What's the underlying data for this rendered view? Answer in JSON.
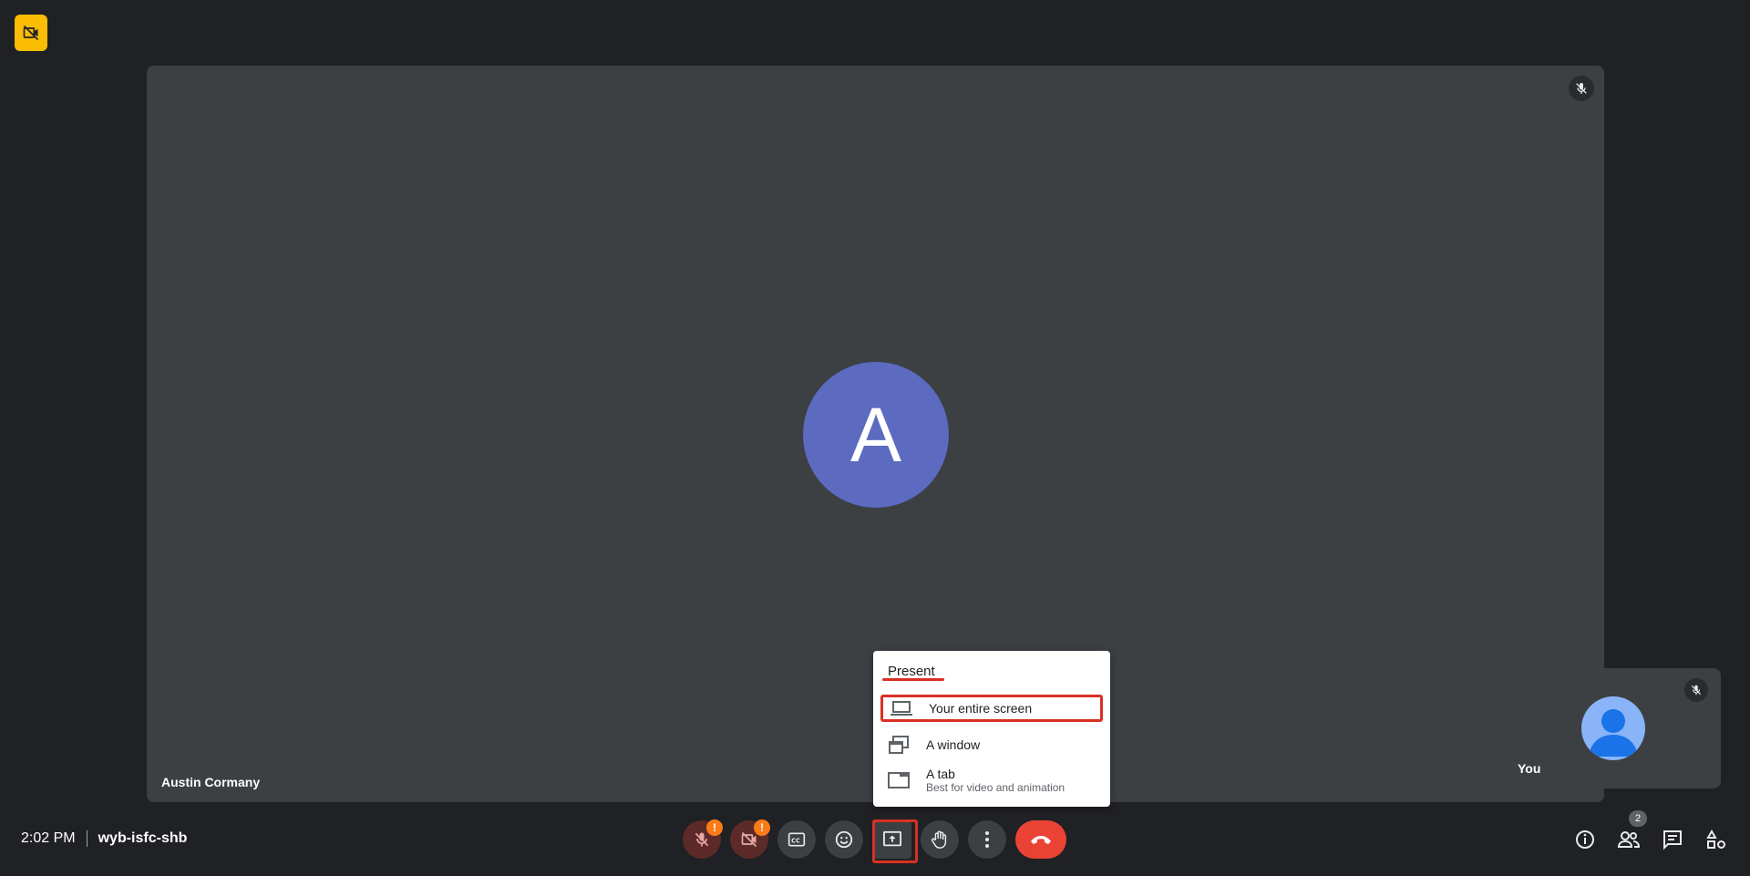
{
  "meeting": {
    "time": "2:02 PM",
    "code": "wyb-isfc-shb"
  },
  "main_tile": {
    "avatar_letter": "A",
    "participant_name": "Austin Cormany",
    "avatar_color": "#5c6bc0",
    "mic_state": "muted"
  },
  "self_tile": {
    "label": "You",
    "mic_state": "muted"
  },
  "present_menu": {
    "title": "Present",
    "items": [
      {
        "label": "Your entire screen",
        "icon": "laptop-icon",
        "highlighted": true
      },
      {
        "label": "A window",
        "icon": "window-icon"
      },
      {
        "label": "A tab",
        "sublabel": "Best for video and animation",
        "icon": "tab-icon"
      }
    ]
  },
  "controls": {
    "mic": {
      "icon": "mic-off-icon",
      "alert": "!"
    },
    "camera": {
      "icon": "camera-off-icon",
      "alert": "!"
    },
    "captions": {
      "icon": "captions-icon"
    },
    "reactions": {
      "icon": "emoji-icon"
    },
    "present": {
      "icon": "present-screen-icon",
      "highlighted": true
    },
    "raise_hand": {
      "icon": "hand-icon"
    },
    "more": {
      "icon": "more-vert-icon"
    },
    "end_call": {
      "icon": "end-call-icon"
    }
  },
  "right_controls": {
    "info": {
      "icon": "info-icon"
    },
    "people": {
      "icon": "people-icon",
      "count": "2"
    },
    "chat": {
      "icon": "chat-icon"
    },
    "activities": {
      "icon": "activities-icon"
    }
  },
  "colors": {
    "background": "#202124",
    "tile": "#3c4043",
    "danger": "#ea4335",
    "highlight": "#d93025",
    "warning_badge": "#fbbc04"
  }
}
